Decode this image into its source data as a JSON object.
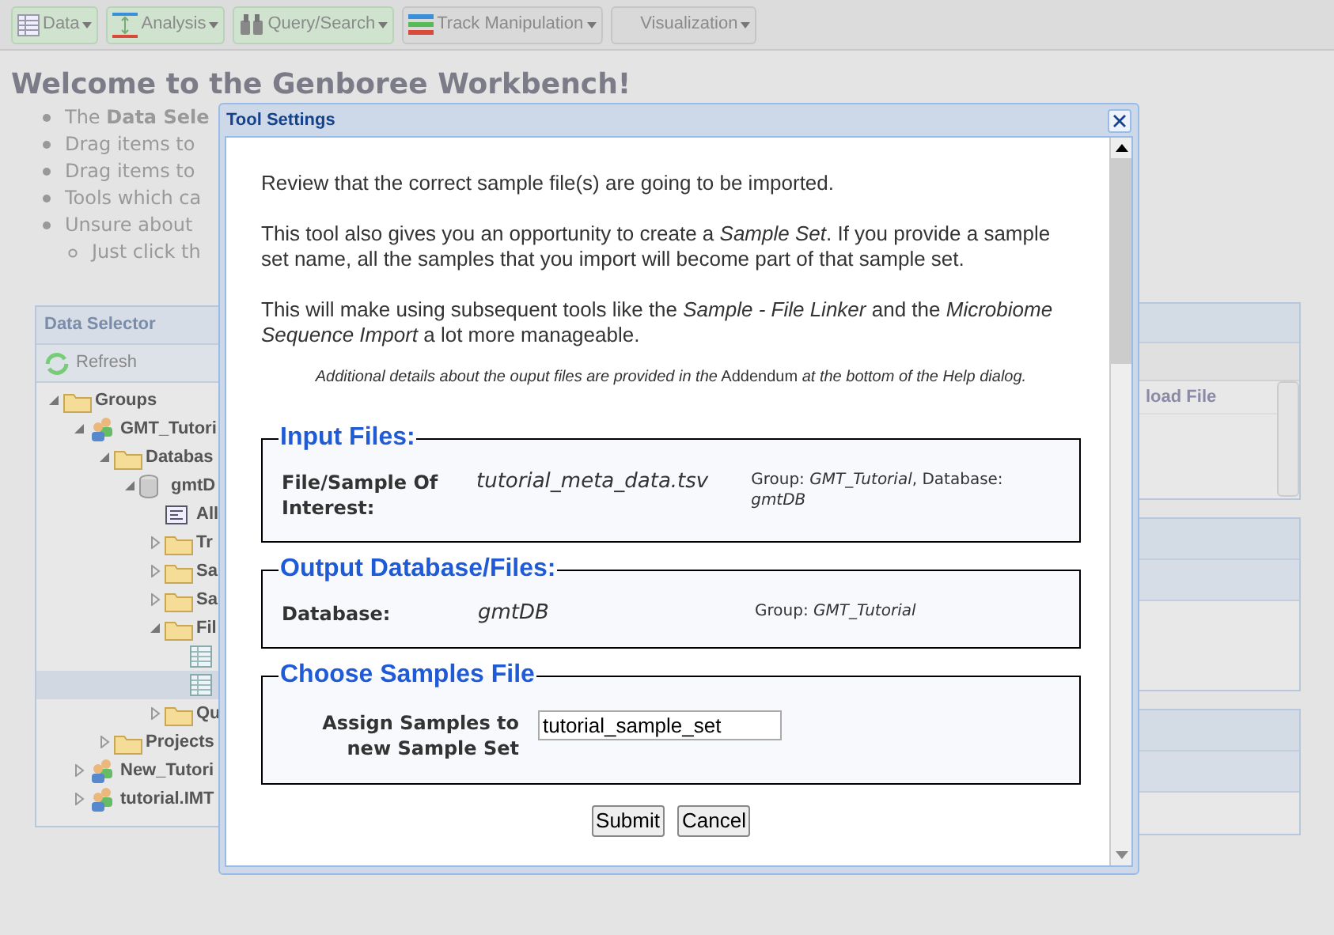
{
  "toolbar": [
    {
      "label": "Data"
    },
    {
      "label": "Analysis"
    },
    {
      "label": "Query/Search"
    },
    {
      "label": "Track Manipulation"
    },
    {
      "label": "Visualization"
    }
  ],
  "welcome": {
    "title": "Welcome to the Genboree Workbench!",
    "bullets": [
      {
        "text": "The **Data Sele**"
      },
      {
        "text": "Drag items to"
      },
      {
        "text": "Drag items to"
      },
      {
        "text": "Tools which ca"
      },
      {
        "text": "Unsure about",
        "children": [
          "Just click th"
        ]
      }
    ]
  },
  "data_selector": {
    "title": "Data Selector",
    "refresh": "Refresh",
    "tree": [
      {
        "label": "Groups",
        "expanded": true,
        "selected": false,
        "children": [
          {
            "label": "GMT_Tutori",
            "expanded": true,
            "selected": false,
            "children": [
              {
                "label": "Databas",
                "expanded": true,
                "selected": false,
                "children": [
                  {
                    "label": "gmtD",
                    "expanded": true,
                    "selected": false,
                    "children": [
                      {
                        "label": "All",
                        "selected": false
                      },
                      {
                        "label": "Tr",
                        "expanded": false,
                        "selected": false
                      },
                      {
                        "label": "Sa",
                        "expanded": false,
                        "selected": false
                      },
                      {
                        "label": "Sa",
                        "expanded": false,
                        "selected": false
                      },
                      {
                        "label": "Fil",
                        "expanded": true,
                        "selected": false,
                        "children": [
                          {
                            "selected": false
                          },
                          {
                            "selected": true
                          }
                        ]
                      },
                      {
                        "label": "Qu",
                        "expanded": false,
                        "selected": false
                      }
                    ]
                  }
                ]
              },
              {
                "label": "Projects",
                "expanded": false,
                "selected": false
              }
            ]
          },
          {
            "label": "New_Tutori",
            "expanded": false,
            "selected": false
          },
          {
            "label": "tutorial.IMT",
            "expanded": false,
            "selected": false
          }
        ]
      }
    ]
  },
  "right_panel": {
    "column_1": "load File"
  },
  "dialog": {
    "title": "Tool Settings",
    "paragraphs": [
      "Review that the correct sample file(s) are going to be imported.",
      "This tool also gives you an opportunity to create a *Sample Set*. If you provide a sample set name, all the samples that you import will become part of that sample set.",
      "This will make using subsequent tools like the *Sample - File Linker* and the *Microbiome Sequence Import* a lot more manageable."
    ],
    "note": "*Additional details about the ouput files are provided in the* Addendum *at the bottom of the Help dialog.*",
    "sections": [
      {
        "legend": "Input Files:",
        "kind": "info",
        "label": "File/Sample Of Interest:",
        "value": "tutorial_meta_data.tsv",
        "detail": "Group: *GMT_Tutorial*, Database: *gmtDB*"
      },
      {
        "legend": "Output Database/Files:",
        "kind": "info",
        "label": "Database:",
        "value": "gmtDB",
        "detail": "Group: *GMT_Tutorial*"
      },
      {
        "legend": "Choose Samples File",
        "kind": "input",
        "label": "Assign Samples to new Sample Set",
        "value": "tutorial_sample_set"
      }
    ],
    "buttons": [
      "Submit",
      "Cancel"
    ]
  }
}
